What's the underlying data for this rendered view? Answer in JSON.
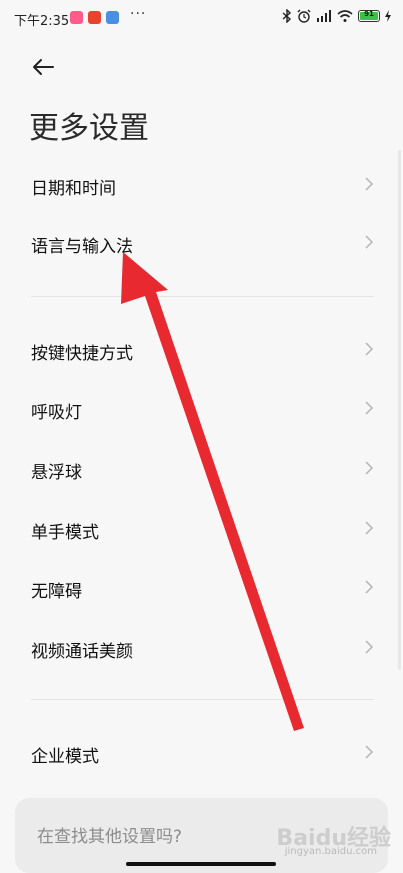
{
  "status_bar": {
    "time": "下午2:35",
    "battery": "91"
  },
  "header": {
    "title": "更多设置"
  },
  "settings": {
    "group1": [
      "日期和时间",
      "语言与输入法"
    ],
    "group2": [
      "按键快捷方式",
      "呼吸灯",
      "悬浮球",
      "单手模式",
      "无障碍",
      "视频通话美颜"
    ],
    "group3": [
      "企业模式"
    ]
  },
  "search": {
    "prompt": "在查找其他设置吗?"
  },
  "watermark": {
    "logo": "Baidu经验",
    "sub": "jingyan.baidu.com"
  },
  "colors": {
    "annotation_arrow": "#e8292f",
    "battery_fill": "#3cc04a"
  },
  "icons": [
    "back-arrow-icon",
    "chevron-right-icon",
    "bluetooth-icon",
    "alarm-icon",
    "signal-icon",
    "wifi-icon",
    "battery-icon",
    "charging-icon"
  ]
}
